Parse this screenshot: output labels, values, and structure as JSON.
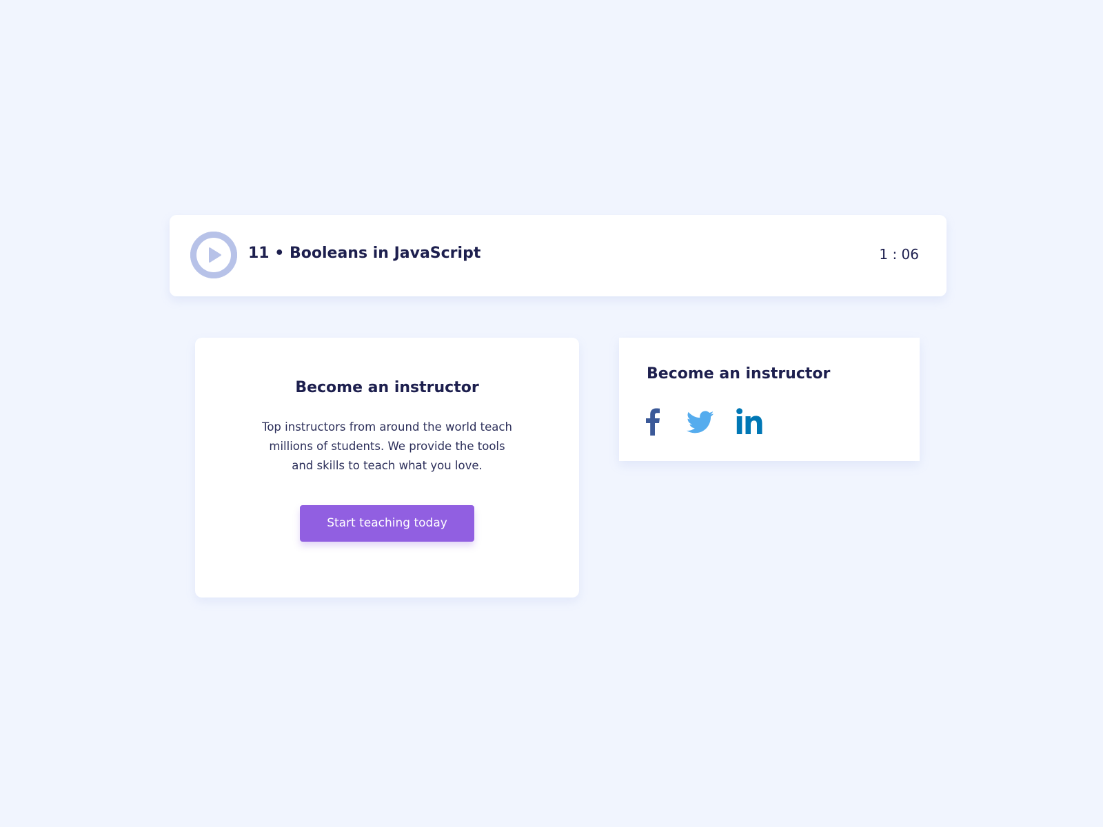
{
  "lesson": {
    "number": "11",
    "separator": "•",
    "title": "11 • Booleans in JavaScript",
    "duration": "1 : 06",
    "play_icon": "play-circle-icon"
  },
  "cta_card": {
    "title": "Become an instructor",
    "description": "Top instructors from around the world teach millions of students. We provide the tools and skills to teach what you love.",
    "button_label": "Start teaching today"
  },
  "social_card": {
    "title": "Become an instructor",
    "icons": [
      "facebook-icon",
      "twitter-icon",
      "linkedin-icon"
    ]
  },
  "colors": {
    "background": "#f1f5fe",
    "text": "#1d1f4e",
    "button": "#915fe1",
    "play_ring": "#b7c2e8",
    "facebook": "#3b5998",
    "twitter": "#55acee",
    "linkedin": "#0077b5"
  }
}
